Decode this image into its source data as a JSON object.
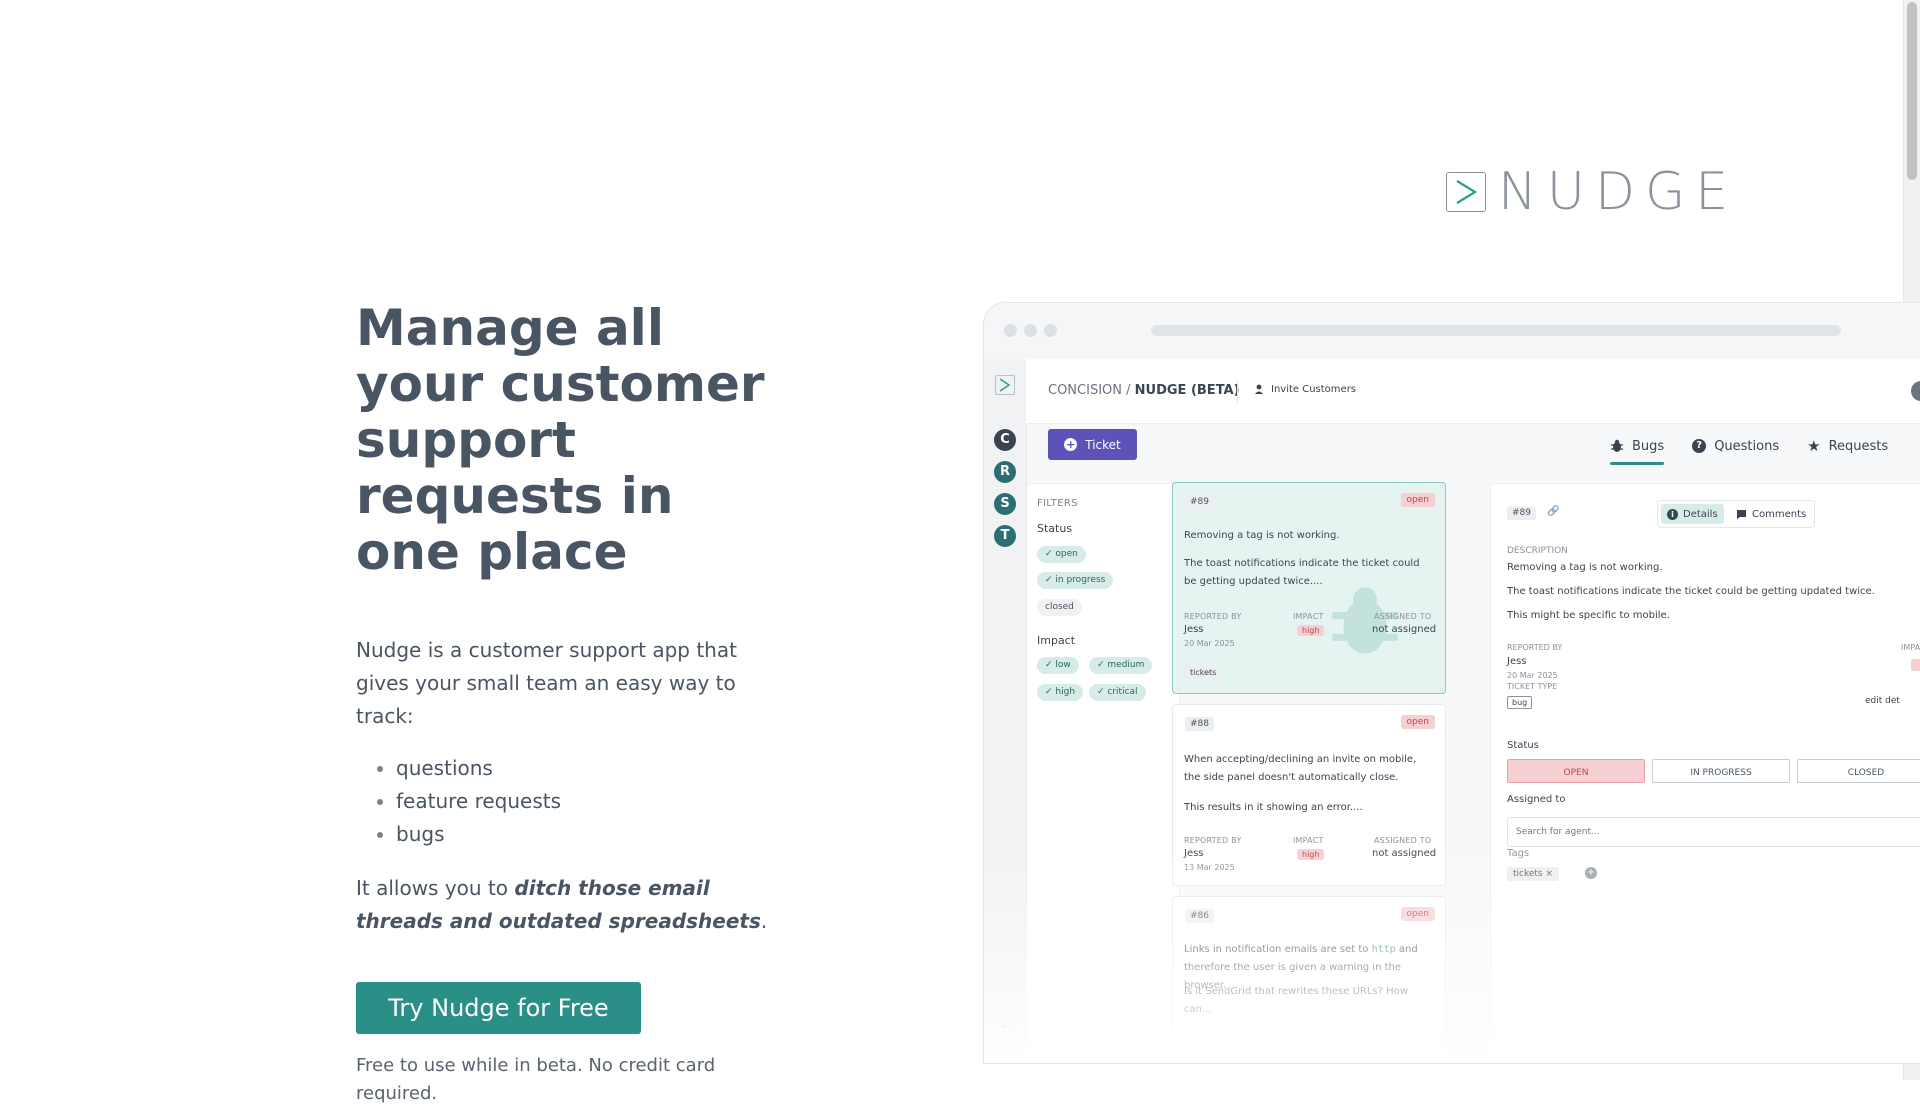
{
  "brand": {
    "name": "NUDGE"
  },
  "hero": {
    "title": "Manage all your customer support requests in one place",
    "description": "Nudge is a customer support app that gives your small team an easy way to track:",
    "features": [
      "questions",
      "feature requests",
      "bugs"
    ],
    "tagline_prefix": "It allows you to ",
    "tagline_emphasis": "ditch those email threads and outdated spreadsheets",
    "tagline_suffix": ".",
    "cta_label": "Try Nudge for Free",
    "cta_note": "Free to use while in beta. No credit card required."
  },
  "app": {
    "workspaces": [
      "C",
      "R",
      "S",
      "T"
    ],
    "breadcrumb_org": "CONCISION /",
    "breadcrumb_project": "NUDGE (BETA)",
    "invite_label": "Invite Customers",
    "ticket_button": "Ticket",
    "tabs": [
      "Bugs",
      "Questions",
      "Requests"
    ],
    "filters": {
      "heading": "FILTERS",
      "status_label": "Status",
      "status_options": [
        "open",
        "in progress",
        "closed"
      ],
      "impact_label": "Impact",
      "impact_options": [
        "low",
        "medium",
        "high",
        "critical"
      ]
    },
    "tickets": [
      {
        "number": "#89",
        "status": "open",
        "title": "Removing a tag is not working.",
        "description": "The toast notifications indicate the ticket could be getting updated twice....",
        "reported_by_label": "REPORTED BY",
        "reporter": "Jess",
        "date": "20 Mar 2025",
        "impact_label": "IMPACT",
        "impact": "high",
        "assigned_label": "ASSIGNED TO",
        "assignee": "not assigned",
        "tag": "tickets"
      },
      {
        "number": "#88",
        "status": "open",
        "title": "When accepting/declining an invite on mobile, the side panel doesn't automatically close.",
        "description": "This results in it showing an error....",
        "reported_by_label": "REPORTED BY",
        "reporter": "Jess",
        "date": "13 Mar 2025",
        "impact_label": "IMPACT",
        "impact": "high",
        "assigned_label": "ASSIGNED TO",
        "assignee": "not assigned"
      },
      {
        "number": "#86",
        "status": "open",
        "line1_prefix": "Links in notification emails are set to ",
        "line1_code": "http",
        "line1_suffix": " and",
        "line2": "therefore the user is given a warning in the browser.",
        "line3": "Is it SendGrid that rewrites these URLs? How can..."
      }
    ],
    "detail": {
      "number": "#89",
      "tab_details": "Details",
      "tab_comments": "Comments",
      "description_label": "DESCRIPTION",
      "description_lines": [
        "Removing a tag is not working.",
        "The toast notifications indicate the ticket could be getting updated twice.",
        "This might be specific to mobile."
      ],
      "reported_by_label": "REPORTED BY",
      "reporter": "Jess",
      "date": "20 Mar 2025",
      "impact_label": "IMPA",
      "ticket_type_label": "TICKET TYPE",
      "ticket_type": "bug",
      "edit_label": "edit det",
      "status_label": "Status",
      "status_buttons": [
        "OPEN",
        "IN PROGRESS",
        "CLOSED"
      ],
      "assigned_label": "Assigned to",
      "assign_placeholder": "Search for agent...",
      "tags_label": "Tags",
      "tag": "tickets",
      "tag_remove": "×"
    }
  },
  "colors": {
    "primary": "#2a8f86",
    "ticket_button": "#5b53b8",
    "text": "#4a5563",
    "open_badge_bg": "#f6cfd3",
    "open_badge_text": "#b8484f"
  }
}
